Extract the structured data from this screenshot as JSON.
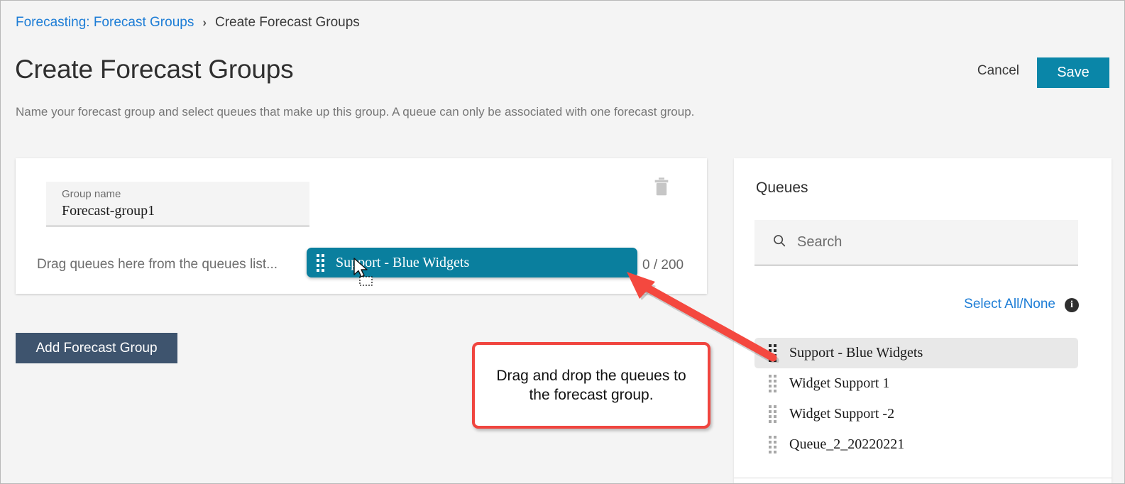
{
  "breadcrumb": {
    "link": "Forecasting: Forecast Groups",
    "separator": "›",
    "current": "Create Forecast Groups"
  },
  "header": {
    "title": "Create Forecast Groups",
    "cancel_label": "Cancel",
    "save_label": "Save",
    "subtitle": "Name your forecast group and select queues that make up this group. A queue can only be associated with one forecast group."
  },
  "group_card": {
    "name_label": "Group name",
    "name_value": "Forecast-group1",
    "drop_hint": "Drag queues here from the queues list...",
    "counter": "0 / 200",
    "delete_icon": "trash-icon"
  },
  "dragged_chip": {
    "label": "Support - Blue Widgets",
    "handle_icon": "drag-handle-icon"
  },
  "add_group": {
    "label": "Add Forecast Group"
  },
  "queues_panel": {
    "title": "Queues",
    "search": {
      "icon": "search-icon",
      "placeholder": "Search",
      "value": ""
    },
    "select_all_label": "Select All/None",
    "info_icon": "info-icon",
    "info_glyph": "i",
    "items": [
      {
        "label": "Support - Blue Widgets",
        "selected": true
      },
      {
        "label": "Widget Support 1",
        "selected": false
      },
      {
        "label": "Widget Support -2",
        "selected": false
      },
      {
        "label": "Queue_2_20220221",
        "selected": false
      }
    ]
  },
  "annotation": {
    "callout_text": "Drag and drop the queues to the forecast group.",
    "arrow_icon": "red-arrow-icon",
    "cursor_icon": "drag-cursor-icon"
  },
  "colors": {
    "accent_teal": "#0a86a8",
    "chip_teal": "#0a7f9e",
    "link_blue": "#1d7dd6",
    "dark_button": "#3e546e",
    "annotation_red": "#f0453f",
    "page_bg": "#f4f4f4"
  }
}
